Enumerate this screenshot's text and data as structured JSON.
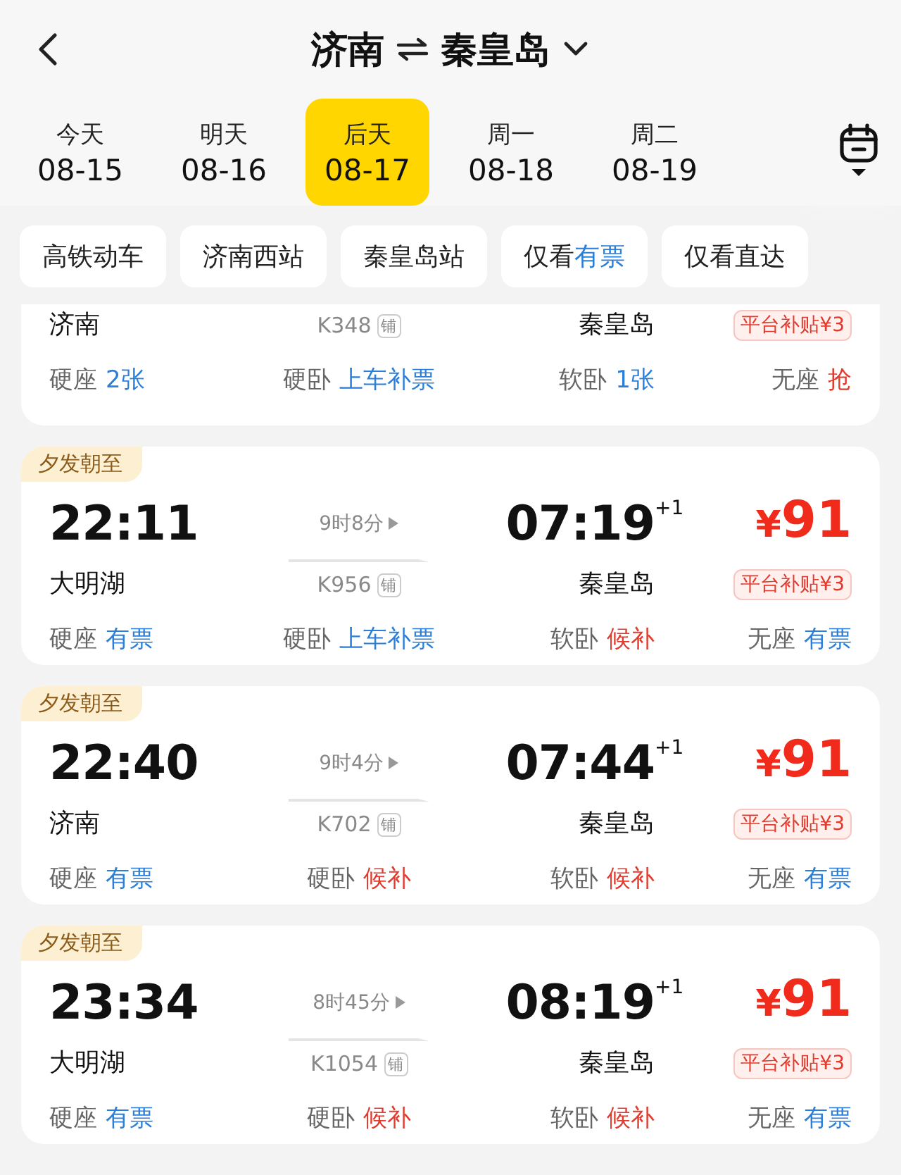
{
  "header": {
    "from": "济南",
    "to": "秦皇岛"
  },
  "dates": [
    {
      "label": "今天",
      "date": "08-15",
      "selected": false
    },
    {
      "label": "明天",
      "date": "08-16",
      "selected": false
    },
    {
      "label": "后天",
      "date": "08-17",
      "selected": true
    },
    {
      "label": "周一",
      "date": "08-18",
      "selected": false
    },
    {
      "label": "周二",
      "date": "08-19",
      "selected": false
    }
  ],
  "filters": [
    {
      "label": "高铁动车"
    },
    {
      "label": "济南西站"
    },
    {
      "label": "秦皇岛站"
    },
    {
      "label": "仅看",
      "highlight": "有票"
    },
    {
      "label": "仅看直达"
    }
  ],
  "trains": [
    {
      "kind": "partial",
      "from_station": "济南",
      "train_no": "K348",
      "berth_tag": "铺",
      "to_station": "秦皇岛",
      "subsidy": "平台补贴¥3",
      "seats": [
        {
          "type": "硬座",
          "status": "2张",
          "color": "#2b7fd9"
        },
        {
          "type": "硬卧",
          "status": "上车补票",
          "color": "#2b7fd9"
        },
        {
          "type": "软卧",
          "status": "1张",
          "color": "#2b7fd9"
        },
        {
          "type": "无座",
          "status": "抢",
          "color": "#e23a2c"
        }
      ]
    },
    {
      "kind": "full",
      "badge": "夕发朝至",
      "depart": "22:11",
      "from_station": "大明湖",
      "duration": "9时8分",
      "train_no": "K956",
      "berth_tag": "铺",
      "arrive": "07:19",
      "day_offset": "+1",
      "to_station": "秦皇岛",
      "currency": "¥",
      "price": "91",
      "subsidy": "平台补贴¥3",
      "seats": [
        {
          "type": "硬座",
          "status": "有票",
          "color": "#2b7fd9"
        },
        {
          "type": "硬卧",
          "status": "上车补票",
          "color": "#2b7fd9"
        },
        {
          "type": "软卧",
          "status": "候补",
          "color": "#e23a2c"
        },
        {
          "type": "无座",
          "status": "有票",
          "color": "#2b7fd9"
        }
      ]
    },
    {
      "kind": "full",
      "badge": "夕发朝至",
      "depart": "22:40",
      "from_station": "济南",
      "duration": "9时4分",
      "train_no": "K702",
      "berth_tag": "铺",
      "arrive": "07:44",
      "day_offset": "+1",
      "to_station": "秦皇岛",
      "currency": "¥",
      "price": "91",
      "subsidy": "平台补贴¥3",
      "seats": [
        {
          "type": "硬座",
          "status": "有票",
          "color": "#2b7fd9"
        },
        {
          "type": "硬卧",
          "status": "候补",
          "color": "#e23a2c"
        },
        {
          "type": "软卧",
          "status": "候补",
          "color": "#e23a2c"
        },
        {
          "type": "无座",
          "status": "有票",
          "color": "#2b7fd9"
        }
      ]
    },
    {
      "kind": "full",
      "badge": "夕发朝至",
      "depart": "23:34",
      "from_station": "大明湖",
      "duration": "8时45分",
      "train_no": "K1054",
      "berth_tag": "铺",
      "arrive": "08:19",
      "day_offset": "+1",
      "to_station": "秦皇岛",
      "currency": "¥",
      "price": "91",
      "subsidy": "平台补贴¥3",
      "seats": [
        {
          "type": "硬座",
          "status": "有票",
          "color": "#2b7fd9"
        },
        {
          "type": "硬卧",
          "status": "候补",
          "color": "#e23a2c"
        },
        {
          "type": "软卧",
          "status": "候补",
          "color": "#e23a2c"
        },
        {
          "type": "无座",
          "status": "有票",
          "color": "#2b7fd9"
        }
      ]
    }
  ]
}
